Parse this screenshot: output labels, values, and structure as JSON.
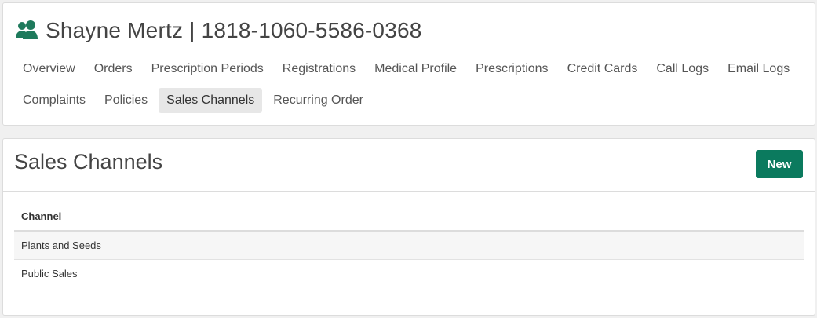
{
  "patient": {
    "icon": "users-icon",
    "title": "Shayne Mertz | 1818-1060-5586-0368"
  },
  "nav": {
    "row1": [
      "Overview",
      "Orders",
      "Prescription Periods",
      "Registrations",
      "Medical Profile",
      "Prescriptions",
      "Credit Cards",
      "Call Logs",
      "Email Logs"
    ],
    "row2": [
      "Complaints",
      "Policies",
      "Sales Channels",
      "Recurring Order"
    ],
    "active": "Sales Channels"
  },
  "section": {
    "title": "Sales Channels",
    "new_label": "New"
  },
  "table": {
    "headers": [
      "Channel"
    ],
    "rows": [
      "Plants and Seeds",
      "Public Sales"
    ]
  },
  "colors": {
    "accent": "#0b7a5e",
    "icon": "#1e7a5c"
  }
}
